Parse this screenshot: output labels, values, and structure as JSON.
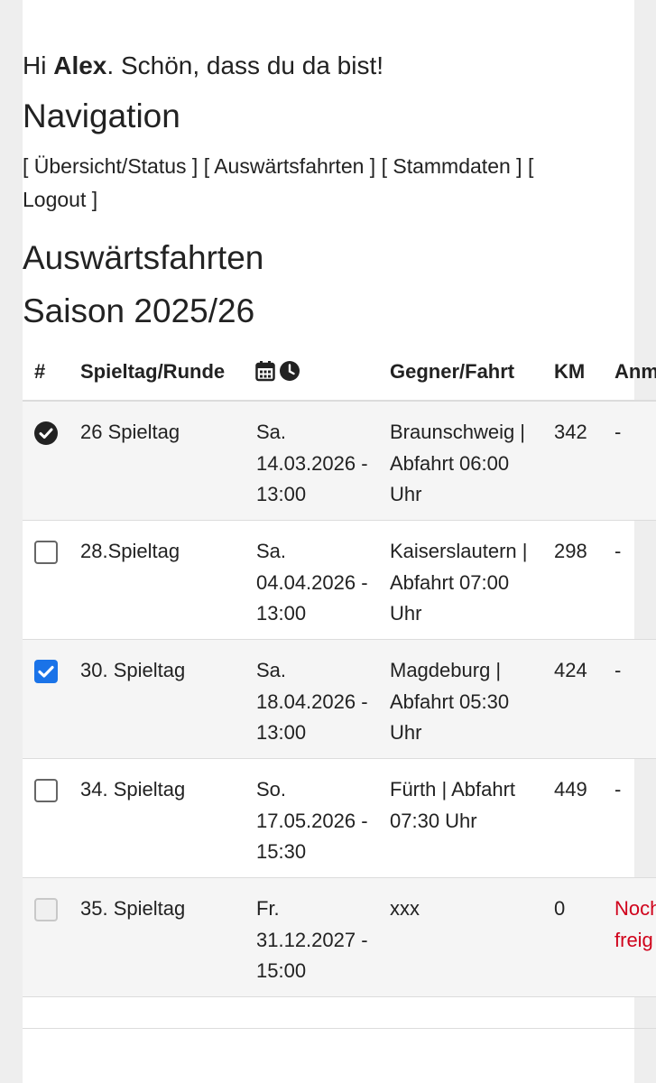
{
  "greeting": {
    "prefix": "Hi ",
    "name": "Alex",
    "suffix": ". Schön, dass du da bist!"
  },
  "navigation": {
    "heading": "Navigation",
    "links": [
      {
        "label": "Übersicht/Status"
      },
      {
        "label": "Auswärtsfahrten"
      },
      {
        "label": "Stammdaten"
      },
      {
        "label": "Logout"
      }
    ]
  },
  "section": {
    "title": "Auswärtsfahrten",
    "season": "Saison 2025/26"
  },
  "table": {
    "headers": {
      "number": "#",
      "spieltag": "Spieltag/Runde",
      "datetime_icons": [
        "calendar-icon",
        "clock-icon"
      ],
      "gegner": "Gegner/Fahrt",
      "km": "KM",
      "anmerkung": "Anm"
    },
    "rows": [
      {
        "status": "done",
        "spieltag": "26 Spieltag",
        "datum": "Sa. 14.03.2026 - 13:00",
        "gegner": "Braunschweig | Abfahrt 06:00 Uhr",
        "km": "342",
        "anmerkung": "-"
      },
      {
        "status": "unchecked",
        "spieltag": "28.Spieltag",
        "datum": "Sa. 04.04.2026 - 13:00",
        "gegner": "Kaiserslautern | Abfahrt 07:00 Uhr",
        "km": "298",
        "anmerkung": "-"
      },
      {
        "status": "checked",
        "spieltag": "30. Spieltag",
        "datum": "Sa. 18.04.2026 - 13:00",
        "gegner": "Magdeburg | Abfahrt 05:30 Uhr",
        "km": "424",
        "anmerkung": "-"
      },
      {
        "status": "unchecked",
        "spieltag": "34. Spieltag",
        "datum": "So. 17.05.2026 - 15:30",
        "gegner": "Fürth | Abfahrt 07:30 Uhr",
        "km": "449",
        "anmerkung": "-"
      },
      {
        "status": "disabled",
        "spieltag": "35. Spieltag",
        "datum": "Fr. 31.12.2027 - 15:00",
        "gegner": "xxx",
        "km": "0",
        "anmerkung": "Noch\nfreig"
      }
    ]
  },
  "colors": {
    "accent": "#1a73e8",
    "warning": "#d0021b",
    "row_alt": "#f5f5f5",
    "page_bg": "#eeeeee"
  }
}
